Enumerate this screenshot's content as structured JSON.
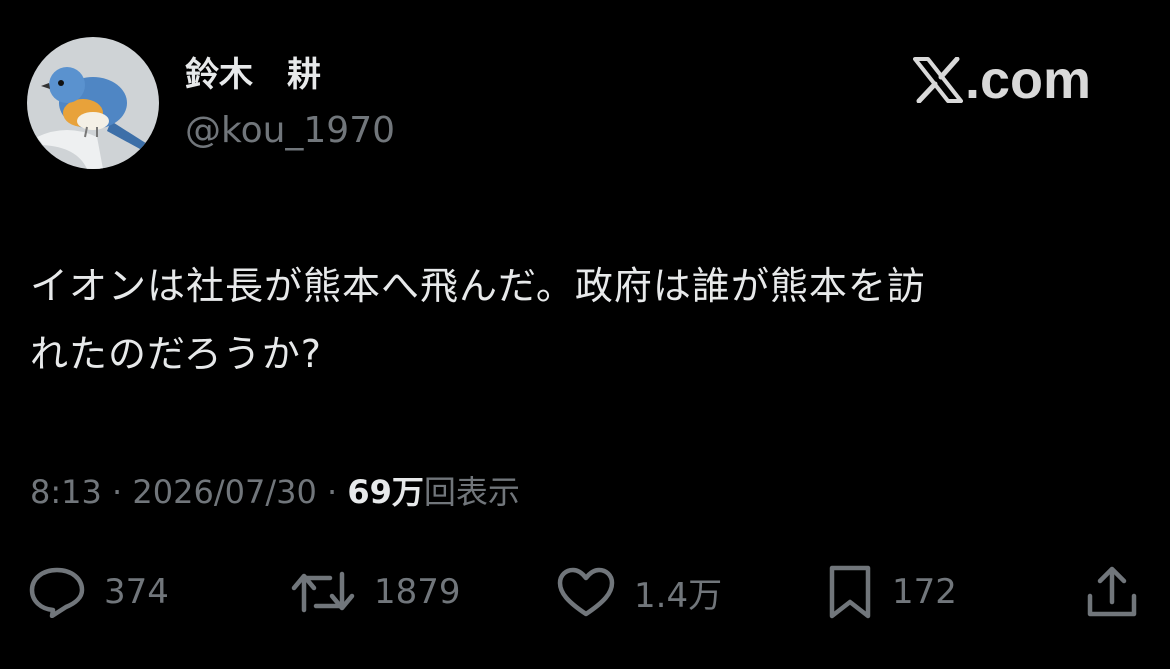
{
  "author": {
    "display_name": "鈴木　耕",
    "handle": "@kou_1970",
    "avatar_icon": "bird-photo-avatar"
  },
  "brand": {
    "text": ".com",
    "icon": "x-logo-icon"
  },
  "tweet": {
    "lines": [
      "イオンは社長が熊本へ飛んだ。政府は誰が熊本を訪",
      "れたのだろうか?"
    ]
  },
  "meta": {
    "time": "8:13",
    "separator": "·",
    "date": "2026/07/30",
    "views_count": "69万",
    "views_label": "回表示"
  },
  "actions": {
    "reply": {
      "icon": "reply-icon",
      "count": "374"
    },
    "retweet": {
      "icon": "retweet-icon",
      "count": "1879"
    },
    "like": {
      "icon": "heart-icon",
      "count": "1.4万"
    },
    "bookmark": {
      "icon": "bookmark-icon",
      "count": "172"
    },
    "share": {
      "icon": "share-icon"
    }
  },
  "colors": {
    "background": "#000000",
    "primary_text": "#e7e9ea",
    "secondary_text": "#71767b"
  }
}
